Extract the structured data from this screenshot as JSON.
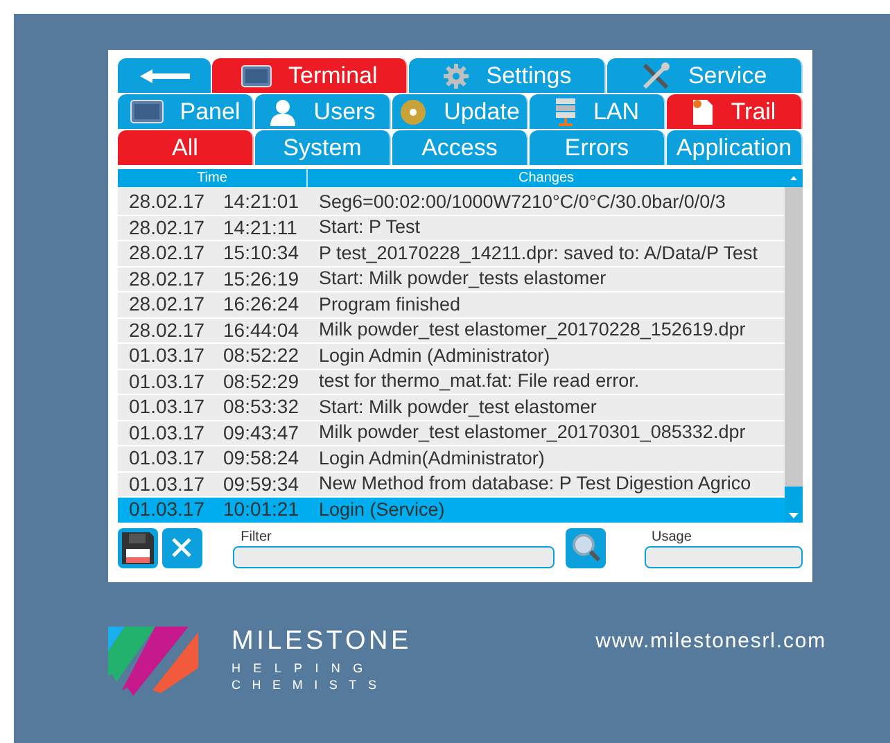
{
  "tab_rows": [
    [
      {
        "label": "Terminal",
        "selected": true
      },
      {
        "label": "Settings",
        "selected": false
      },
      {
        "label": "Service",
        "selected": false
      }
    ],
    [
      {
        "label": "Panel",
        "selected": false
      },
      {
        "label": "Users",
        "selected": false
      },
      {
        "label": "Update",
        "selected": false
      },
      {
        "label": "LAN",
        "selected": false
      },
      {
        "label": "Trail",
        "selected": true
      }
    ],
    [
      {
        "label": "All",
        "selected": true
      },
      {
        "label": "System",
        "selected": false
      },
      {
        "label": "Access",
        "selected": false
      },
      {
        "label": "Errors",
        "selected": false
      },
      {
        "label": "Application",
        "selected": false
      }
    ]
  ],
  "table": {
    "columns": [
      "Time",
      "Changes"
    ],
    "rows": [
      {
        "date": "28.02.17",
        "time": "14:21:01",
        "change": "Seg6=00:02:00/1000W7210°C/0°C/30.0bar/0/0/3",
        "selected": false
      },
      {
        "date": "28.02.17",
        "time": "14:21:11",
        "change": "Start: P Test",
        "selected": false
      },
      {
        "date": "28.02.17",
        "time": "15:10:34",
        "change": "P test_20170228_14211.dpr: saved to: A/Data/P Test",
        "selected": false
      },
      {
        "date": "28.02.17",
        "time": "15:26:19",
        "change": "Start: Milk powder_tests elastomer",
        "selected": false
      },
      {
        "date": "28.02.17",
        "time": "16:26:24",
        "change": "Program finished",
        "selected": false
      },
      {
        "date": "28.02.17",
        "time": "16:44:04",
        "change": "Milk powder_test elastomer_20170228_152619.dpr",
        "selected": false
      },
      {
        "date": "01.03.17",
        "time": "08:52:22",
        "change": "Login Admin (Administrator)",
        "selected": false
      },
      {
        "date": "01.03.17",
        "time": "08:52:29",
        "change": "test for thermo_mat.fat: File read error.",
        "selected": false
      },
      {
        "date": "01.03.17",
        "time": "08:53:32",
        "change": "Start: Milk powder_test elastomer",
        "selected": false
      },
      {
        "date": "01.03.17",
        "time": "09:43:47",
        "change": "Milk powder_test elastomer_20170301_085332.dpr",
        "selected": false
      },
      {
        "date": "01.03.17",
        "time": "09:58:24",
        "change": "Login Admin(Administrator)",
        "selected": false
      },
      {
        "date": "01.03.17",
        "time": "09:59:34",
        "change": "New Method from database: P Test Digestion Agrico",
        "selected": false
      },
      {
        "date": "01.03.17",
        "time": "10:01:21",
        "change": "Login (Service)",
        "selected": true
      }
    ]
  },
  "filter": {
    "label": "Filter"
  },
  "usage": {
    "label": "Usage"
  },
  "brand": {
    "name": "MILESTONE",
    "tagline_1": "HELPING",
    "tagline_2": "CHEMISTS",
    "url": "www.milestonesrl.com"
  }
}
